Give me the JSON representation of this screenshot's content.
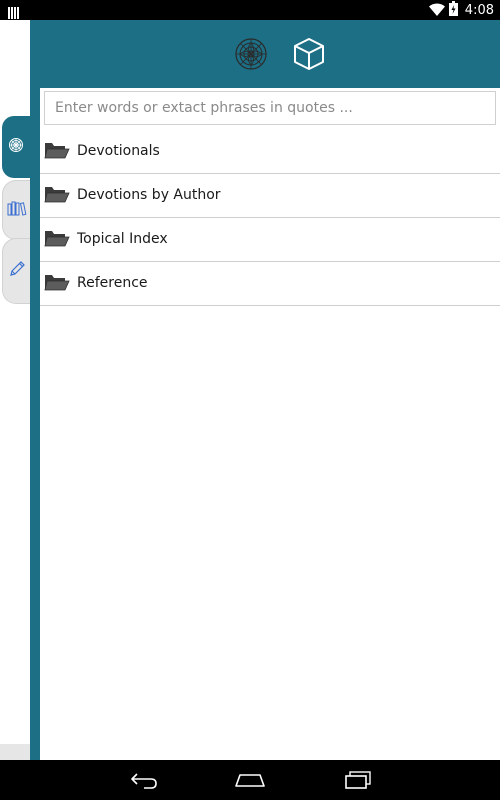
{
  "status_bar": {
    "time": "4:08",
    "icons": [
      "signal-bars-icon",
      "wifi-icon",
      "battery-icon"
    ]
  },
  "header": {
    "icons": [
      "rosette-icon",
      "cube-icon"
    ]
  },
  "left_rail": {
    "tabs": [
      {
        "icon": "rosette-icon",
        "active": true
      },
      {
        "icon": "books-icon",
        "active": false
      },
      {
        "icon": "pencil-icon",
        "active": false
      }
    ]
  },
  "search": {
    "placeholder": "Enter words or extact phrases in quotes ...",
    "value": ""
  },
  "list": {
    "items": [
      {
        "label": "Devotionals",
        "icon": "folder-icon"
      },
      {
        "label": "Devotions by Author",
        "icon": "folder-icon"
      },
      {
        "label": "Topical Index",
        "icon": "folder-icon"
      },
      {
        "label": "Reference",
        "icon": "folder-icon"
      }
    ]
  },
  "nav_bar": {
    "buttons": [
      "back-icon",
      "home-icon",
      "recents-icon"
    ]
  },
  "colors": {
    "accent": "#1d6f85",
    "rail_inactive": "#e6e6e6",
    "divider": "#cfcfcf",
    "tab_icon_blue": "#3a6fd1"
  }
}
